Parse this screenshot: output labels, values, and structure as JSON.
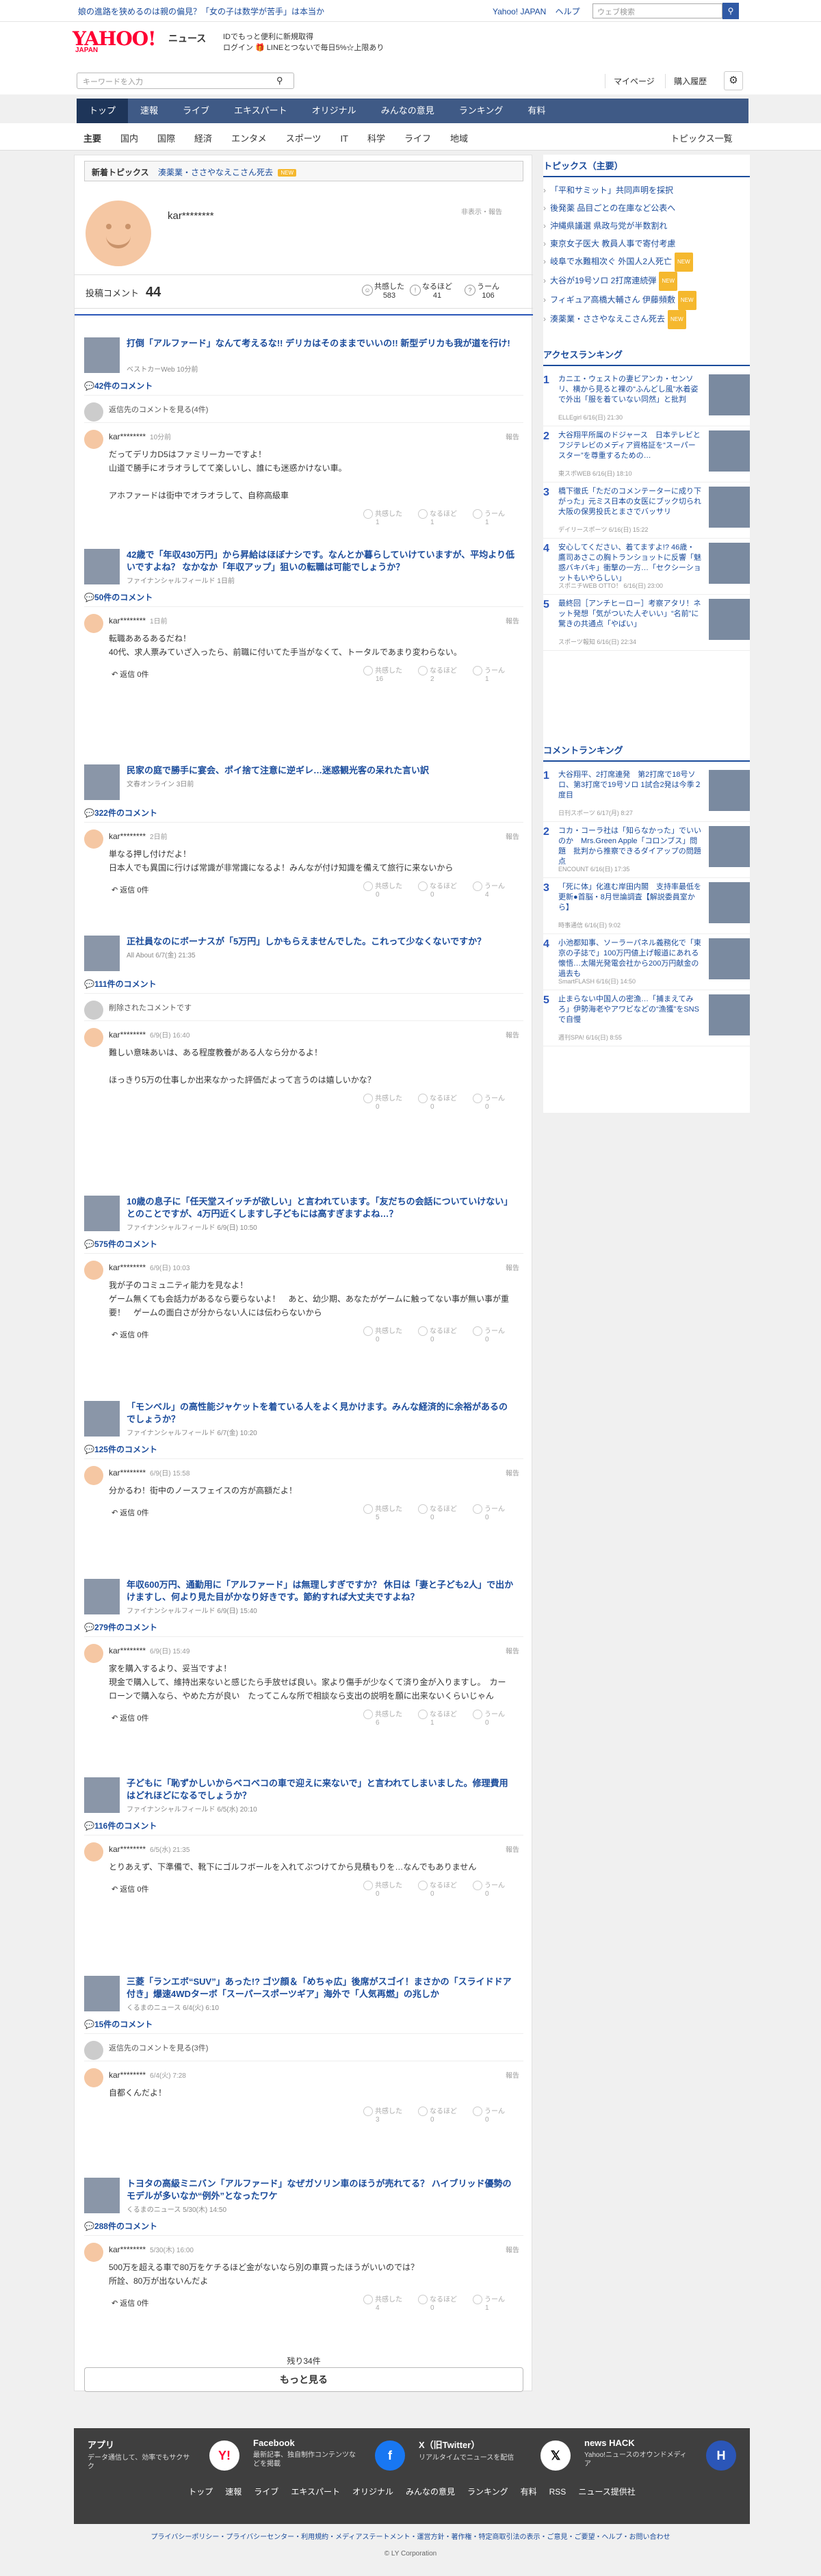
{
  "topbar": {
    "promo": "娘の進路を狭めるのは親の偏見？「女の子は数学が苦手」は本当か",
    "links": [
      "Yahoo! JAPAN",
      "ヘルプ"
    ],
    "search_placeholder": "ウェブ検索"
  },
  "header": {
    "logo": "YAHOO!",
    "logo_sub": "JAPAN",
    "news": "ニュース",
    "promo_line1": "IDでもっと便利に新規取得",
    "promo_line2": "ログイン 🎁 LINEとつないで毎日5%☆上限あり"
  },
  "search": {
    "placeholder": "キーワードを入力",
    "mypage": "マイページ",
    "history": "購入履歴"
  },
  "nav": [
    "トップ",
    "速報",
    "ライブ",
    "エキスパート",
    "オリジナル",
    "みんなの意見",
    "ランキング",
    "有料"
  ],
  "subnav": {
    "items": [
      "主要",
      "国内",
      "国際",
      "経済",
      "エンタメ",
      "スポーツ",
      "IT",
      "科学",
      "ライフ",
      "地域"
    ],
    "right": "トピックス一覧"
  },
  "topics_line": {
    "label": "新着トピックス",
    "text": "湊薬業・ささやなえこさん死去",
    "badge": "NEW"
  },
  "profile": {
    "name": "kar********",
    "report": "非表示・報告"
  },
  "stats": {
    "label": "投稿コメント",
    "count": "44",
    "boxes": [
      {
        "label": "共感した",
        "value": "583"
      },
      {
        "label": "なるほど",
        "value": "41"
      },
      {
        "label": "うーん",
        "value": "106"
      }
    ]
  },
  "entries": [
    {
      "title": "打倒「アルファード」なんて考えるな!! デリカはそのままでいいの!! 新型デリカも我が道を行け!",
      "source": "ベストカーWeb 10分前",
      "comments": "42件のコメント",
      "extra": "返信先のコメントを見る(4件)",
      "user": "kar********",
      "date": "10分前",
      "text": "だってデリカD5はファミリーカーですよ！\n山道で勝手にオラオラしてて楽しいし、誰にも迷惑かけない車。\n\nアホファードは街中でオラオラして、自称高級車",
      "reactions": [
        "共感した\n1",
        "なるほど\n1",
        "うーん\n1"
      ],
      "reply": ""
    },
    {
      "title": "42歳で「年収430万円」から昇給はほぼナシです。なんとか暮らしていけていますが、平均より低いですよね？ なかなか「年収アップ」狙いの転職は可能でしょうか？",
      "source": "ファイナンシャルフィールド 1日前",
      "comments": "50件のコメント",
      "extra": "",
      "user": "kar********",
      "date": "1日前",
      "text": "転職ああるあるだね！\n40代、求人票みていざ入ったら、前職に付いてた手当がなくて、トータルであまり変わらない。",
      "reactions": [
        "共感した\n16",
        "なるほど\n2",
        "うーん\n1"
      ],
      "reply": "返信 0件"
    },
    {
      "title": "民家の庭で勝手に宴会、ポイ捨て注意に逆ギレ…迷惑観光客の呆れた言い訳",
      "source": "文春オンライン 3日前",
      "comments": "322件のコメント",
      "extra": "",
      "user": "kar********",
      "date": "2日前",
      "text": "単なる押し付けだよ！\n日本人でも異国に行けば常識が非常識になるよ！みんなが付け知識を備えて旅行に来ないから",
      "reactions": [
        "共感した\n0",
        "なるほど\n0",
        "うーん\n4"
      ],
      "reply": "返信 0件"
    },
    {
      "title": "正社員なのにボーナスが「5万円」しかもらえませんでした。これって少なくないですか？",
      "source": "All About 6/7(金) 21:35",
      "comments": "111件のコメント",
      "extra": "削除されたコメントです",
      "user": "kar********",
      "date": "6/9(日) 16:40",
      "text": "難しい意味あいは、ある程度教養がある人なら分かるよ！\n\nほっきり5万の仕事しか出来なかった評価だよって言うのは嬉しいかな？",
      "reactions": [
        "共感した\n0",
        "なるほど\n0",
        "うーん\n0"
      ],
      "reply": ""
    },
    {
      "title": "10歳の息子に「任天堂スイッチが欲しい」と言われています。「友だちの会話についていけない」とのことですが、4万円近くしますし子どもには高すぎますよね…？",
      "source": "ファイナンシャルフィールド 6/9(日) 10:50",
      "comments": "575件のコメント",
      "extra": "",
      "user": "kar********",
      "date": "6/9(日) 10:03",
      "text": "我が子のコミュニティ能力を見なよ！\nゲーム無くても会話力があるなら要らないよ！　あと、幼少期、あなたがゲームに触ってない事が無い事が重要！　ゲームの面白さが分からない人には伝わらないから",
      "reactions": [
        "共感した\n0",
        "なるほど\n0",
        "うーん\n0"
      ],
      "reply": "返信 0件"
    },
    {
      "title": "「モンベル」の高性能ジャケットを着ている人をよく見かけます。みんな経済的に余裕があるのでしょうか？",
      "source": "ファイナンシャルフィールド 6/7(金) 10:20",
      "comments": "125件のコメント",
      "extra": "",
      "user": "kar********",
      "date": "6/9(日) 15:58",
      "text": "分かるわ！街中のノースフェイスの方が高額だよ！",
      "reactions": [
        "共感した\n5",
        "なるほど\n0",
        "うーん\n0"
      ],
      "reply": "返信 0件"
    },
    {
      "title": "年収600万円、通勤用に「アルファード」は無理しすぎですか？ 休日は「妻と子ども2人」で出かけますし、何より見た目がかなり好きです。節約すれば大丈夫ですよね？",
      "source": "ファイナンシャルフィールド 6/9(日) 15:40",
      "comments": "279件のコメント",
      "extra": "",
      "user": "kar********",
      "date": "6/9(日) 15:49",
      "text": "家を購入するより、妥当ですよ！\n現金で購入して、維持出来ないと感じたら手放せば良い。家より傷手が少なくて済り金が入りますし。　カーローンで購入なら、やめた方が良い　たってこんな所で相談なら支出の説明を願に出来ないくらいじゃん",
      "reactions": [
        "共感した\n6",
        "なるほど\n1",
        "うーん\n0"
      ],
      "reply": "返信 0件"
    },
    {
      "title": "子どもに「恥ずかしいからベコベコの車で迎えに来ないで」と言われてしまいました。修理費用はどれほどになるでしょうか？",
      "source": "ファイナンシャルフィールド 6/5(水) 20:10",
      "comments": "116件のコメント",
      "extra": "",
      "user": "kar********",
      "date": "6/5(水) 21:35",
      "text": "とりあえず、下準備で、靴下にゴルフボールを入れてぶつけてから見積もりを…なんでもありません",
      "reactions": [
        "共感した\n0",
        "なるほど\n0",
        "うーん\n0"
      ],
      "reply": "返信 0件"
    },
    {
      "title": "三菱「ランエボ“SUV”」あった!? ゴツ顔＆「めちゃ広」後席がスゴイ！まさかの「スライドドア付き」爆速4WDターボ「スーパースポーツギア」海外で「人気再燃」の兆しか",
      "source": "くるまのニュース 6/4(火) 6:10",
      "comments": "15件のコメント",
      "extra": "返信先のコメントを見る(3件)",
      "user": "kar********",
      "date": "6/4(火) 7:28",
      "text": "自都くんだよ！",
      "reactions": [
        "共感した\n3",
        "なるほど\n0",
        "うーん\n0"
      ],
      "reply": ""
    },
    {
      "title": "トヨタの高級ミニバン「アルファード」なぜガソリン車のほうが売れてる？ ハイブリッド優勢のモデルが多いなか“例外”となったワケ",
      "source": "くるまのニュース 5/30(木) 14:50",
      "comments": "288件のコメント",
      "extra": "",
      "user": "kar********",
      "date": "5/30(木) 16:00",
      "text": "500万を超える車で80万をケチるほど金がないなら別の車買ったほうがいいのでは？\n所詮、80万が出ないんだよ",
      "reactions": [
        "共感した\n4",
        "なるほど\n0",
        "うーん\n1"
      ],
      "reply": "返信 0件"
    }
  ],
  "more": {
    "remaining": "残り34件",
    "button": "もっと見る"
  },
  "side": {
    "topics_title": "トピックス（主要）",
    "topics": [
      {
        "text": "「平和サミット」共同声明を採択",
        "new": false
      },
      {
        "text": "後発薬 品目ごとの在庫など公表へ",
        "new": false
      },
      {
        "text": "沖縄県議選 県政与党が半数割れ",
        "new": false
      },
      {
        "text": "東京女子医大 教員人事で寄付考慮",
        "new": false
      },
      {
        "text": "岐阜で水難相次ぐ 外国人2人死亡",
        "new": true
      },
      {
        "text": "大谷が19号ソロ 2打席連続弾",
        "new": true
      },
      {
        "text": "フィギュア高橋大輔さん 伊藤頻敷",
        "new": true
      },
      {
        "text": "湊薬業・ささやなえこさん死去",
        "new": true
      }
    ],
    "access_title": "アクセスランキング",
    "access": [
      {
        "num": "1",
        "title": "カニエ・ウェストの妻ビアンカ・センソリ、横から見ると裸の“ふんどし風”水着姿で外出「服を着ていない同然」と批判",
        "src": "ELLEgirl 6/16(日) 21:30"
      },
      {
        "num": "2",
        "title": "大谷翔平所属のドジャース　日本テレビとフジテレビのメディア資格証を“スーパースター”を尊重するための…",
        "src": "東スポWEB 6/16(日) 18:10"
      },
      {
        "num": "3",
        "title": "橋下徹氏「ただのコメンテーターに成り下がった」元ミス日本の女医にブック切られ　大阪の保男投氏とまさでバッサリ",
        "src": "デイリースポーツ 6/16(日) 15:22"
      },
      {
        "num": "4",
        "title": "安心してください、着てますよ!? 46歳・鷹司あさこの胸トランショットに反響「魅惑バキバキ」衝撃の一方…「セクシーショットもいやらしい」",
        "src": "スポニチWEB OTTO！ 6/16(日) 23:00"
      },
      {
        "num": "5",
        "title": "最終回［アンチヒーロー］考察アタリ！ネット発想「気がついた人ぞいい」“名前”に驚きの共通点「やばい」",
        "src": "スポーツ報知 6/16(日) 22:34"
      }
    ],
    "comment_title": "コメントランキング",
    "comment": [
      {
        "num": "1",
        "title": "大谷翔平、2打席連発　第2打席で18号ソロ、第3打席で19号ソロ 1試合2発は今季２度目",
        "src": "日刊スポーツ 6/17(月) 8:27"
      },
      {
        "num": "2",
        "title": "コカ・コーラ社は「知らなかった」でいいのか　Mrs.Green Apple「コロンブス」問題　批判から推察できるダイアップの問題点",
        "src": "ENCOUNT 6/16(日) 17:35"
      },
      {
        "num": "3",
        "title": "「死に体」化進む岸田内閣　支持率最低を更新●首脳・8月世論調査【解説委員室から】",
        "src": "時事通信 6/16(日) 9:02"
      },
      {
        "num": "4",
        "title": "小池都知事、ソーラーパネル義務化で「東京の子誌で」100万円値上げ報道にあれる懐悟…太陽光発電会社から200万円献金の過去も",
        "src": "SmartFLASH 6/16(日) 14:50"
      },
      {
        "num": "5",
        "title": "止まらない中国人の密漁…「捕まえてみろ」伊勢海老やアワビなどの“漁獲”をSNSで自慢",
        "src": "週刊SPA! 6/16(日) 8:55"
      }
    ]
  },
  "footer": {
    "cells": [
      {
        "h": "アプリ",
        "d": "データ通信して、効率でもサクサク",
        "icon": "Y!"
      },
      {
        "h": "Facebook",
        "d": "最新記事、独自制作コンテンツなどを掲載",
        "icon": "f"
      },
      {
        "h": "X（旧Twitter）",
        "d": "リアルタイムでニュースを配信",
        "icon": "𝕏"
      },
      {
        "h": "news HACK",
        "d": "Yahoo!ニュースのオウンドメディア",
        "icon": "H"
      }
    ],
    "nav": [
      "トップ",
      "速報",
      "ライブ",
      "エキスパート",
      "オリジナル",
      "みんなの意見",
      "ランキング",
      "有料",
      "RSS",
      "ニュース提供社"
    ],
    "links": "プライバシーポリシー・プライバシーセンター・利用規約・メディアステートメント・運営方針・著作権・特定商取引法の表示・ご意見・ご要望・ヘルプ・お問い合わせ",
    "copyright": "© LY Corporation"
  },
  "colors": {
    "nav_bg": "#3f5a86",
    "link": "#1a4b9b",
    "logo": "#ff0033"
  }
}
